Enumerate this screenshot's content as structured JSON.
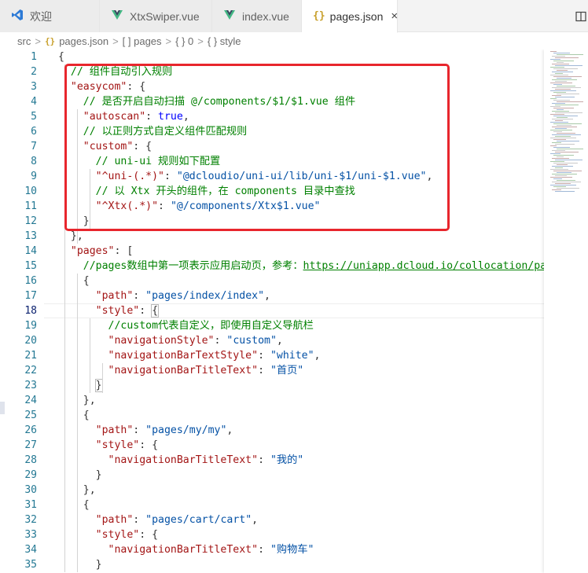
{
  "tabs": [
    {
      "label": "欢迎",
      "icon": "vscode-logo-icon",
      "active": false
    },
    {
      "label": "XtxSwiper.vue",
      "icon": "vue-file-icon",
      "active": false
    },
    {
      "label": "index.vue",
      "icon": "vue-file-icon",
      "active": false
    },
    {
      "label": "pages.json",
      "icon": "json-file-icon",
      "active": true,
      "close": "×"
    }
  ],
  "tab_icon_text": {
    "json": "{}"
  },
  "breadcrumb": [
    "src",
    "pages.json",
    "[ ] pages",
    "{ } 0",
    "{ } style"
  ],
  "breadcrumb_separator": ">",
  "current_line": 18,
  "lines": [
    {
      "n": 1,
      "t": [
        [
          "p",
          "{"
        ]
      ]
    },
    {
      "n": 2,
      "t": [
        [
          "c",
          "  // 组件自动引入规则"
        ]
      ]
    },
    {
      "n": 3,
      "t": [
        [
          "k",
          "  \"easycom\""
        ],
        [
          "p",
          ": {"
        ]
      ]
    },
    {
      "n": 4,
      "t": [
        [
          "c",
          "    // 是否开启自动扫描 @/components/$1/$1.vue 组件"
        ]
      ]
    },
    {
      "n": 5,
      "t": [
        [
          "k",
          "    \"autoscan\""
        ],
        [
          "p",
          ": "
        ],
        [
          "b",
          "true"
        ],
        [
          "p",
          ","
        ]
      ]
    },
    {
      "n": 6,
      "t": [
        [
          "c",
          "    // 以正则方式自定义组件匹配规则"
        ]
      ]
    },
    {
      "n": 7,
      "t": [
        [
          "k",
          "    \"custom\""
        ],
        [
          "p",
          ": {"
        ]
      ]
    },
    {
      "n": 8,
      "t": [
        [
          "c",
          "      // uni-ui 规则如下配置"
        ]
      ]
    },
    {
      "n": 9,
      "t": [
        [
          "k",
          "      \"^uni-(.*)\""
        ],
        [
          "p",
          ": "
        ],
        [
          "s",
          "\"@dcloudio/uni-ui/lib/uni-$1/uni-$1.vue\""
        ],
        [
          "p",
          ","
        ]
      ]
    },
    {
      "n": 10,
      "t": [
        [
          "c",
          "      // 以 Xtx 开头的组件，在 components 目录中查找"
        ]
      ]
    },
    {
      "n": 11,
      "t": [
        [
          "k",
          "      \"^Xtx(.*)\""
        ],
        [
          "p",
          ": "
        ],
        [
          "s",
          "\"@/components/Xtx$1.vue\""
        ]
      ]
    },
    {
      "n": 12,
      "t": [
        [
          "p",
          "    }"
        ]
      ]
    },
    {
      "n": 13,
      "t": [
        [
          "p",
          "  },"
        ]
      ]
    },
    {
      "n": 14,
      "t": [
        [
          "k",
          "  \"pages\""
        ],
        [
          "p",
          ": ["
        ]
      ]
    },
    {
      "n": 15,
      "t": [
        [
          "c",
          "    //pages数组中第一项表示应用启动页，参考："
        ],
        [
          "u",
          "https://uniapp.dcloud.io/collocation/pa"
        ]
      ]
    },
    {
      "n": 16,
      "t": [
        [
          "p",
          "    {"
        ]
      ]
    },
    {
      "n": 17,
      "t": [
        [
          "k",
          "      \"path\""
        ],
        [
          "p",
          ": "
        ],
        [
          "s",
          "\"pages/index/index\""
        ],
        [
          "p",
          ","
        ]
      ]
    },
    {
      "n": 18,
      "t": [
        [
          "k",
          "      \"style\""
        ],
        [
          "p",
          ": "
        ],
        [
          "bm",
          "{"
        ]
      ]
    },
    {
      "n": 19,
      "t": [
        [
          "c",
          "        //custom代表自定义，即使用自定义导航栏"
        ]
      ]
    },
    {
      "n": 20,
      "t": [
        [
          "k",
          "        \"navigationStyle\""
        ],
        [
          "p",
          ": "
        ],
        [
          "s",
          "\"custom\""
        ],
        [
          "p",
          ","
        ]
      ]
    },
    {
      "n": 21,
      "t": [
        [
          "k",
          "        \"navigationBarTextStyle\""
        ],
        [
          "p",
          ": "
        ],
        [
          "s",
          "\"white\""
        ],
        [
          "p",
          ","
        ]
      ]
    },
    {
      "n": 22,
      "t": [
        [
          "k",
          "        \"navigationBarTitleText\""
        ],
        [
          "p",
          ": "
        ],
        [
          "s",
          "\"首页\""
        ]
      ]
    },
    {
      "n": 23,
      "t": [
        [
          "p",
          "      "
        ],
        [
          "bm",
          "}"
        ]
      ]
    },
    {
      "n": 24,
      "t": [
        [
          "p",
          "    },"
        ]
      ]
    },
    {
      "n": 25,
      "t": [
        [
          "p",
          "    {"
        ]
      ]
    },
    {
      "n": 26,
      "t": [
        [
          "k",
          "      \"path\""
        ],
        [
          "p",
          ": "
        ],
        [
          "s",
          "\"pages/my/my\""
        ],
        [
          "p",
          ","
        ]
      ]
    },
    {
      "n": 27,
      "t": [
        [
          "k",
          "      \"style\""
        ],
        [
          "p",
          ": {"
        ]
      ]
    },
    {
      "n": 28,
      "t": [
        [
          "k",
          "        \"navigationBarTitleText\""
        ],
        [
          "p",
          ": "
        ],
        [
          "s",
          "\"我的\""
        ]
      ]
    },
    {
      "n": 29,
      "t": [
        [
          "p",
          "      }"
        ]
      ]
    },
    {
      "n": 30,
      "t": [
        [
          "p",
          "    },"
        ]
      ]
    },
    {
      "n": 31,
      "t": [
        [
          "p",
          "    {"
        ]
      ]
    },
    {
      "n": 32,
      "t": [
        [
          "k",
          "      \"path\""
        ],
        [
          "p",
          ": "
        ],
        [
          "s",
          "\"pages/cart/cart\""
        ],
        [
          "p",
          ","
        ]
      ]
    },
    {
      "n": 33,
      "t": [
        [
          "k",
          "      \"style\""
        ],
        [
          "p",
          ": {"
        ]
      ]
    },
    {
      "n": 34,
      "t": [
        [
          "k",
          "        \"navigationBarTitleText\""
        ],
        [
          "p",
          ": "
        ],
        [
          "s",
          "\"购物车\""
        ]
      ]
    },
    {
      "n": 35,
      "t": [
        [
          "p",
          "      }"
        ]
      ]
    }
  ],
  "colors": {
    "key": "#a31515",
    "string": "#0451a5",
    "comment": "#008000",
    "boolean": "#0000ff",
    "line_number": "#237893",
    "highlight_box": "#e8262d"
  }
}
